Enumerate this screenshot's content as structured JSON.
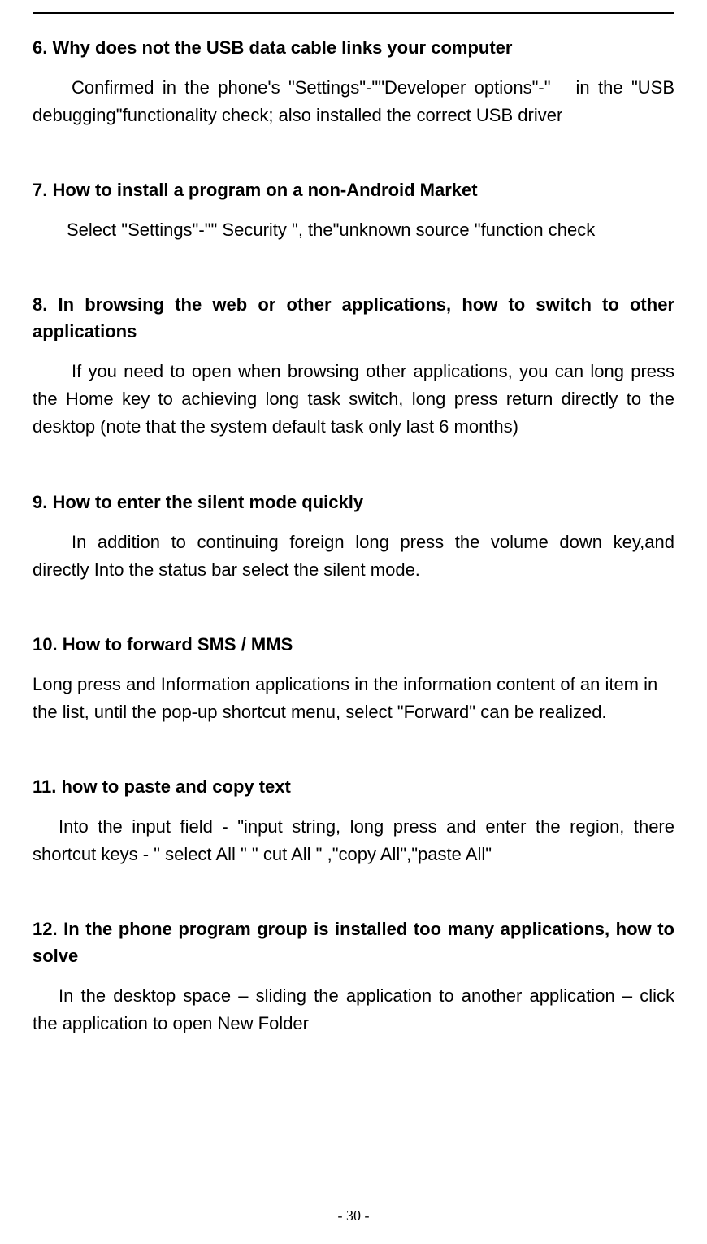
{
  "sections": {
    "s6": {
      "heading": "6. Why does not the USB data cable links your computer",
      "body": "Confirmed in the phone's \"Settings\"-\"\"Developer options\"-\"   in the \"USB debugging\"functionality check; also installed the correct USB driver"
    },
    "s7": {
      "heading": "7. How to install a program on a non-Android Market",
      "body": "Select \"Settings\"-\"\" Security \", the\"unknown source \"function check"
    },
    "s8": {
      "heading": "8.  In  browsing  the  web  or  other  applications,  how  to  switch  to  other applications",
      "body": "If you need to open when browsing other applications, you can long press the Home key to achieving long task switch, long press return directly to the desktop (note that the system default task only last 6 months)"
    },
    "s9": {
      "heading": "9. How to enter the silent mode quickly",
      "body": "In addition to continuing foreign long press the volume down key,and directly Into the status bar select the silent mode."
    },
    "s10": {
      "heading": "10. How to forward SMS / MMS",
      "body": "Long press and Information applications in the information content of an item in the list, until the pop-up shortcut menu, select \"Forward\" can be realized."
    },
    "s11": {
      "heading": "11. how to paste and copy text",
      "body": "Into the input field - \"input string, long press and enter the region, there shortcut keys - \" select All \" \" cut All \" ,\"copy All\",\"paste All\""
    },
    "s12": {
      "heading": "12. In the phone program group is installed too many applications, how to solve",
      "body": "In the desktop space – sliding the application to another application – click the application to open New Folder"
    }
  },
  "page_number": "- 30 -"
}
